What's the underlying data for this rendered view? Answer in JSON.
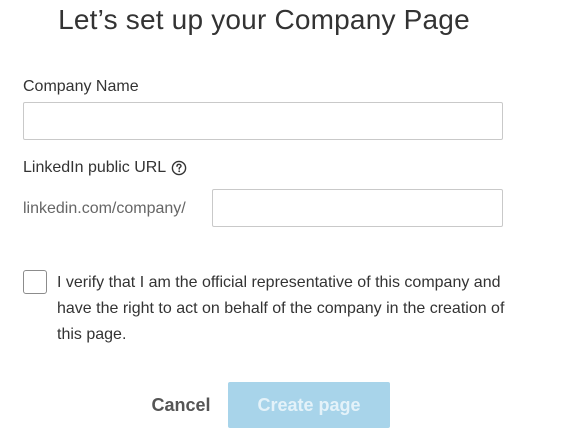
{
  "page": {
    "title": "Let’s set up your Company Page"
  },
  "form": {
    "company_name_label": "Company Name",
    "company_name_value": "",
    "url_label": "LinkedIn public URL",
    "url_prefix": "linkedin.com/company/",
    "url_value": "",
    "verify_text": "I verify that I am the official representative of this company and have the right to act on behalf of the company in the creation of this page.",
    "verify_checked": false
  },
  "actions": {
    "cancel_label": "Cancel",
    "create_label": "Create page",
    "create_disabled": true
  },
  "icons": {
    "help": "question-circle-icon"
  },
  "colors": {
    "primary_disabled": "#a8d4ea",
    "primary_disabled_text": "#e4f2f9",
    "text": "#333333",
    "muted": "#666666",
    "border": "#c9c9c9"
  }
}
